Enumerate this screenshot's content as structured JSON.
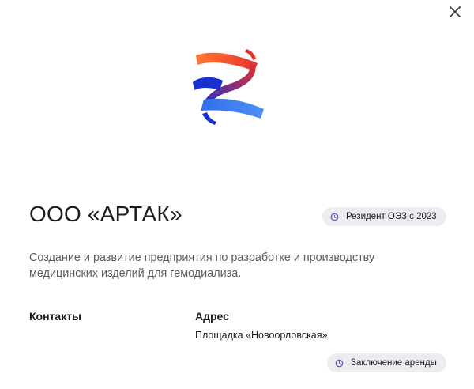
{
  "company": {
    "name": "ООО «АРТАК»",
    "description": "Создание и развитие предприятия по разработке и производству медицинских изделий для гемодиализа."
  },
  "badges": {
    "resident": "Резидент ОЭЗ с 2023",
    "lease": "Заключение аренды"
  },
  "sections": {
    "contacts_label": "Контакты",
    "address_label": "Адрес",
    "address_value": "Площадка «Новоорловская»"
  },
  "icons": {
    "close": "close-icon",
    "badge": "clock-icon",
    "logo": "artak-logo"
  },
  "colors": {
    "logo_red": "#e8302c",
    "logo_orange": "#ff6a2e",
    "logo_blue": "#3d7bf0",
    "logo_navy": "#1a2fd0",
    "badge_icon": "#7b57c9",
    "pill_bg": "#ececf1"
  }
}
